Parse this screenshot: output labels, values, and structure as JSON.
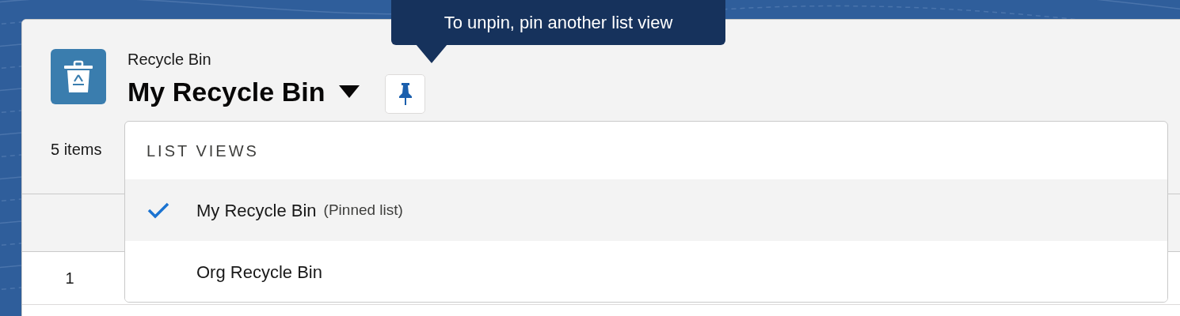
{
  "header": {
    "object_label": "Recycle Bin",
    "list_title": "My Recycle Bin",
    "pin_tooltip": "To unpin, pin another list view"
  },
  "summary": "5 items",
  "list_views_menu": {
    "heading": "LIST VIEWS",
    "items": [
      {
        "label": "My Recycle Bin",
        "note": "(Pinned list)",
        "selected": true
      },
      {
        "label": "Org Recycle Bin",
        "selected": false
      }
    ]
  },
  "table": {
    "rows": [
      {
        "row_number": "1"
      }
    ]
  }
}
